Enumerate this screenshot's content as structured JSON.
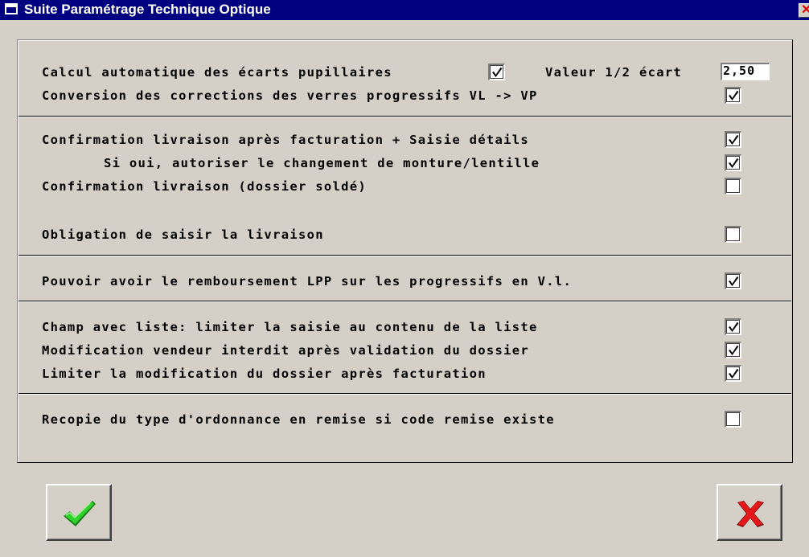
{
  "window": {
    "title": "Suite Paramétrage Technique Optique",
    "close_icon": "close-icon"
  },
  "options": {
    "calcul_auto": {
      "label": "Calcul automatique des écarts pupillaires",
      "checked": true
    },
    "demi_ecart": {
      "label": "Valeur 1/2 écart",
      "value": "2,50"
    },
    "conversion": {
      "label": "Conversion des corrections des verres progressifs VL -> VP",
      "checked": true
    },
    "confirm_facturation": {
      "label": "Confirmation livraison après facturation + Saisie détails",
      "checked": true
    },
    "autoriser_changement": {
      "label": "Si oui, autoriser le changement de monture/lentille",
      "checked": true
    },
    "confirm_solde": {
      "label": "Confirmation livraison (dossier soldé)",
      "checked": false
    },
    "obligation_livraison": {
      "label": "Obligation de saisir la livraison",
      "checked": false
    },
    "remboursement_lpp": {
      "label": "Pouvoir avoir le remboursement LPP sur les progressifs en V.l.",
      "checked": true
    },
    "champ_liste": {
      "label": "Champ avec liste: limiter la saisie au contenu de la liste",
      "checked": true
    },
    "modif_vendeur": {
      "label": "Modification vendeur interdit après validation du dossier",
      "checked": true
    },
    "limiter_modif": {
      "label": "Limiter la modification du dossier après facturation",
      "checked": true
    },
    "recopie_ordonnance": {
      "label": "Recopie du type d'ordonnance en remise si code remise existe",
      "checked": false
    }
  },
  "buttons": {
    "ok_icon": "green-check-icon",
    "cancel_icon": "red-x-icon"
  },
  "colors": {
    "titlebar": "#000080",
    "face": "#d4d0c8",
    "ok": "#22c020",
    "cancel": "#e01010"
  }
}
